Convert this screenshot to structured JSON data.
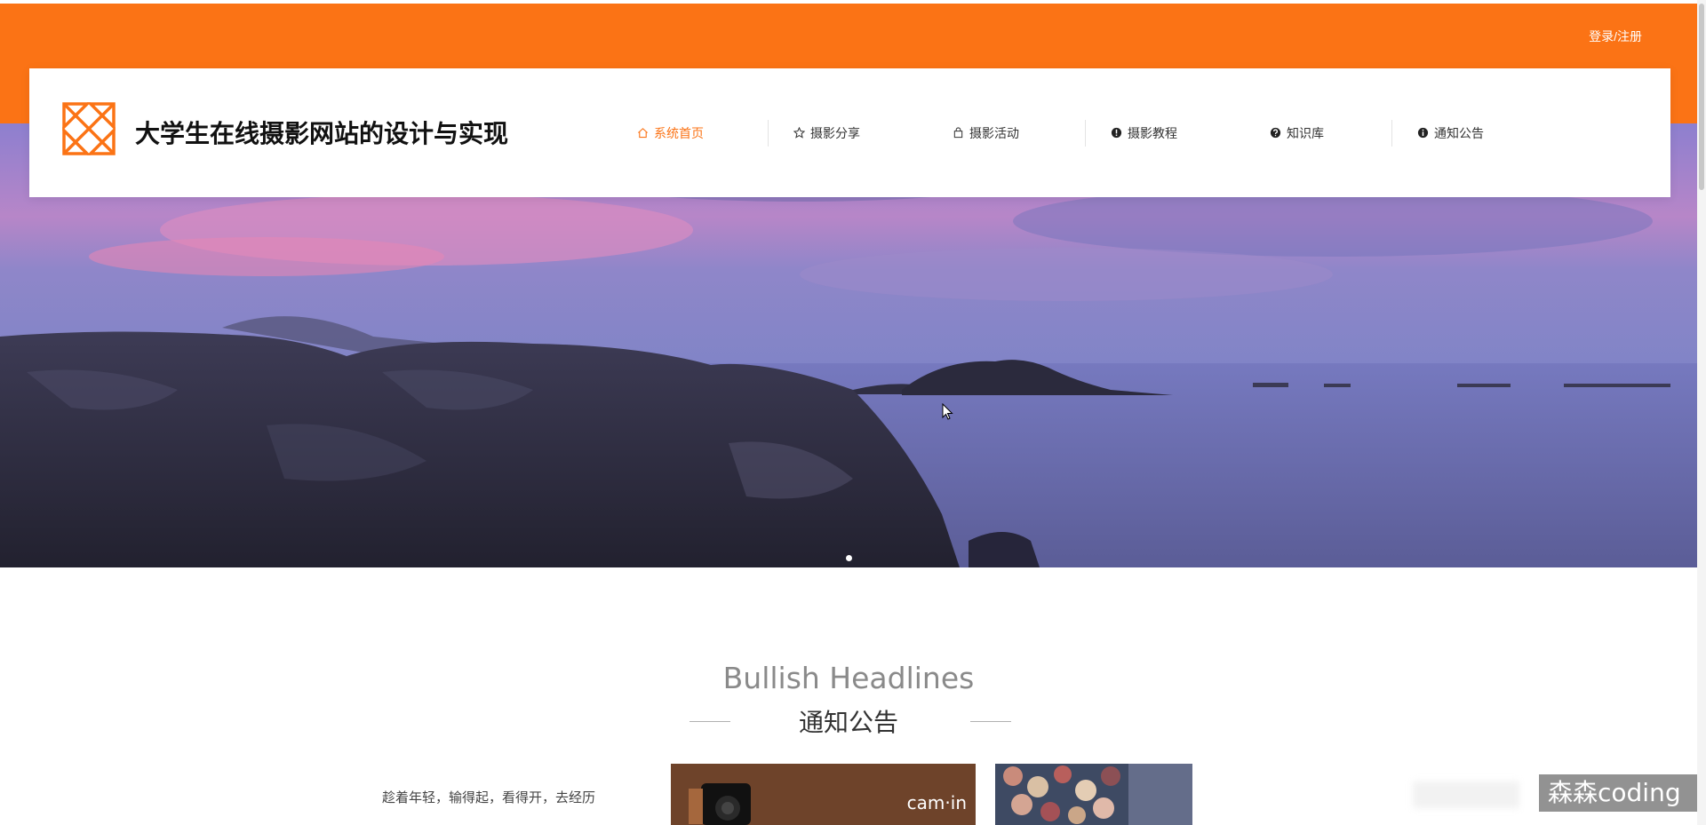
{
  "topbar": {
    "login_label": "登录/注册",
    "accent": "#fb7315"
  },
  "header": {
    "title": "大学生在线摄影网站的设计与实现",
    "nav": [
      {
        "label": "系统首页",
        "icon": "home-icon",
        "active": true
      },
      {
        "label": "摄影分享",
        "icon": "star-icon",
        "active": false
      },
      {
        "label": "摄影活动",
        "icon": "bag-icon",
        "active": false
      },
      {
        "label": "摄影教程",
        "icon": "info-circle-icon",
        "active": false
      },
      {
        "label": "知识库",
        "icon": "question-circle-icon",
        "active": false
      },
      {
        "label": "通知公告",
        "icon": "info-circle-icon",
        "active": false
      }
    ]
  },
  "section": {
    "title_en": "Bullish Headlines",
    "title_cn": "通知公告"
  },
  "news": {
    "quote": "趁着年轻，输得起，看得开，去经历",
    "card1_text": "cam·in"
  },
  "watermark": "森森coding"
}
